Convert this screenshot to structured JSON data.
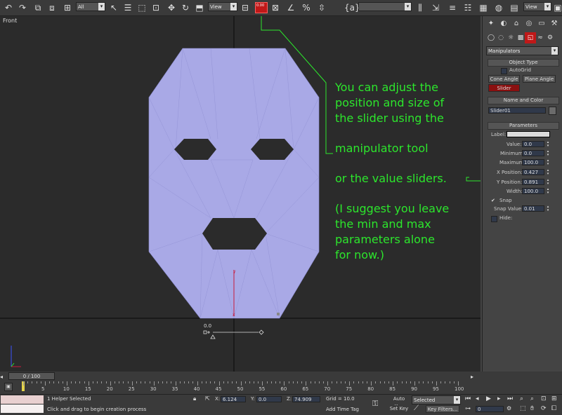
{
  "toolbar": {
    "filter_value": "All",
    "refcoord_value": "View",
    "viewport_value": "View",
    "slider_icon_text": "0.00"
  },
  "viewport": {
    "label": "Front",
    "slider_value": "0.0",
    "axis_y": "y",
    "axis_x": "x"
  },
  "annotations": {
    "line1": "You can adjust the",
    "line2": "position and size of",
    "line3": "the slider using the",
    "line4": "manipulator tool",
    "line5": "or the value sliders.",
    "line6": "(I suggest you leave",
    "line7": "the min and max",
    "line8": "parameters alone",
    "line9": "for now.)"
  },
  "command_panel": {
    "category": "Manipulators",
    "object_type": {
      "header": "Object Type",
      "autogrid_label": "AutoGrid",
      "autogrid_checked": false,
      "buttons": [
        "Cone Angle",
        "Plane Angle",
        "Slider"
      ],
      "active_button": "Slider"
    },
    "name_color": {
      "header": "Name and Color",
      "name": "Slider01"
    },
    "parameters": {
      "header": "Parameters",
      "label_label": "Label:",
      "label_value": "",
      "value_label": "Value:",
      "value": "0.0",
      "minimum_label": "Minimum:",
      "minimum": "0.0",
      "maximum_label": "Maximum:",
      "maximum": "100.0",
      "xpos_label": "X Position:",
      "xpos": "0.427",
      "ypos_label": "Y Position:",
      "ypos": "0.891",
      "width_label": "Width:",
      "width": "100.0",
      "snap_label": "Snap",
      "snap_checked": true,
      "snapvalue_label": "Snap Value:",
      "snapvalue": "0.01",
      "hide_label": "Hide:"
    }
  },
  "timeline": {
    "frame": "0 / 100",
    "ticks": [
      "0",
      "5",
      "10",
      "15",
      "20",
      "25",
      "30",
      "35",
      "40",
      "45",
      "50",
      "55",
      "60",
      "65",
      "70",
      "75",
      "80",
      "85",
      "90",
      "95",
      "100"
    ]
  },
  "status": {
    "selection": "1 Helper Selected",
    "prompt": "Click and drag to begin creation process",
    "x_label": "X:",
    "x_value": "6.124",
    "y_label": "Y:",
    "y_value": "0.0",
    "z_label": "Z:",
    "z_value": "74.909",
    "grid": "Grid = 10.0",
    "add_time_tag": "Add Time Tag",
    "auto_key": "Auto Key",
    "selected": "Selected",
    "set_key": "Set Key",
    "key_filters": "Key Filters...",
    "frame_field": "0"
  },
  "colors": {
    "mesh_fill": "#a9a9e6",
    "annotation_green": "#2ce62c",
    "active_button": "#8a1010"
  }
}
